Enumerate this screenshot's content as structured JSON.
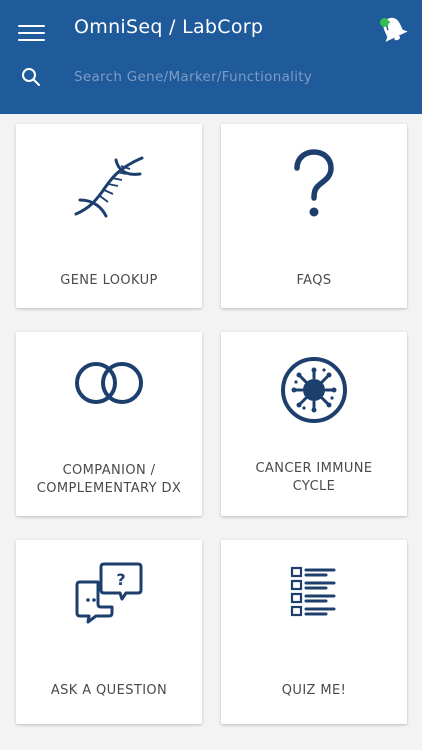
{
  "header": {
    "title": "OmniSeq / LabCorp",
    "menu_icon": "hamburger-menu-icon",
    "notification_icon": "bell-icon",
    "notification_status_color": "#33c04a",
    "background_color": "#1f5a9b"
  },
  "search": {
    "placeholder": "Search Gene/Marker/Functionality",
    "value": "",
    "icon": "search-icon"
  },
  "tiles": [
    {
      "label": "GENE LOOKUP",
      "icon": "dna-icon"
    },
    {
      "label": "FAQS",
      "icon": "question-mark-icon"
    },
    {
      "label_line1": "COMPANION /",
      "label_line2": "COMPLEMENTARY DX",
      "icon": "linked-rings-icon"
    },
    {
      "label_line1": "CANCER IMMUNE",
      "label_line2": "CYCLE",
      "icon": "virus-cell-icon"
    },
    {
      "label": "ASK A QUESTION",
      "icon": "chat-bubbles-icon"
    },
    {
      "label": "QUIZ ME!",
      "icon": "checklist-icon"
    }
  ],
  "colors": {
    "accent": "#1f5a9b",
    "icon": "#1d3f6e",
    "tile_text": "#4a4a4a"
  }
}
